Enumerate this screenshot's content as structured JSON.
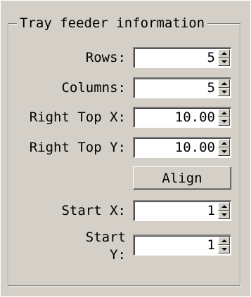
{
  "group": {
    "title": "Tray feeder information"
  },
  "fields": [
    {
      "label": "Rows:",
      "value": "5"
    },
    {
      "label": "Columns:",
      "value": "5"
    },
    {
      "label": "Right Top X:",
      "value": "10.00"
    },
    {
      "label": "Right Top Y:",
      "value": "10.00"
    },
    {
      "label": "Start X:",
      "value": "1"
    },
    {
      "label_line1": "Start",
      "label_line2": "Y:",
      "value": "1"
    }
  ],
  "buttons": {
    "align_label": "Align"
  },
  "icons": {
    "spin_up": "spin-up-arrow-icon",
    "spin_down": "spin-down-arrow-icon"
  },
  "colors": {
    "dialog_background": "#d4d0c8",
    "field_background": "#ffffff",
    "text": "#000000"
  }
}
